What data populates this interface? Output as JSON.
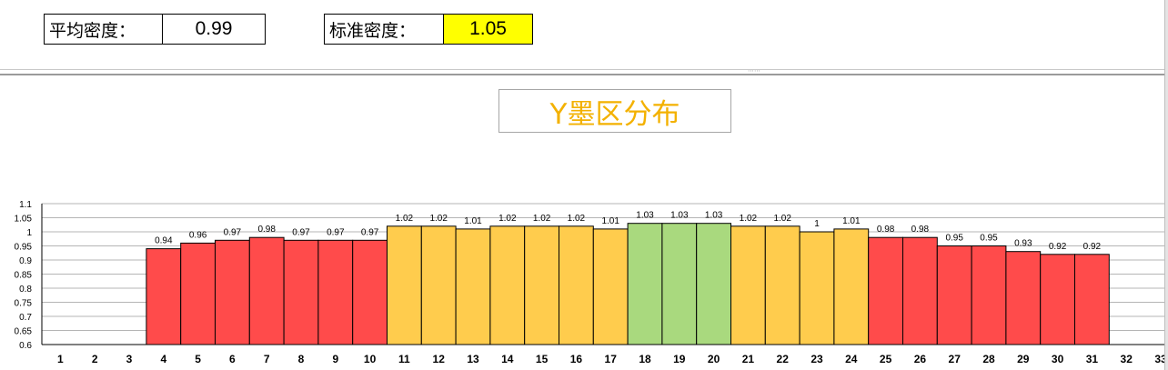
{
  "stats": {
    "avg_label": "平均密度：",
    "avg_value": "0.99",
    "std_label": "标准密度：",
    "std_value": "1.05",
    "std_highlight_color": "#ffff00"
  },
  "splitter_grip": "⋯⋯",
  "chart_data": {
    "type": "bar",
    "title": "Y墨区分布",
    "xlabel": "",
    "ylabel": "",
    "ylim": [
      0.6,
      1.1
    ],
    "yticks": [
      "0.6",
      "0.65",
      "0.7",
      "0.75",
      "0.8",
      "0.85",
      "0.9",
      "0.95",
      "1",
      "1.05",
      "1.1"
    ],
    "categories": [
      "1",
      "2",
      "3",
      "4",
      "5",
      "6",
      "7",
      "8",
      "9",
      "10",
      "11",
      "12",
      "13",
      "14",
      "15",
      "16",
      "17",
      "18",
      "19",
      "20",
      "21",
      "22",
      "23",
      "24",
      "25",
      "26",
      "27",
      "28",
      "29",
      "30",
      "31",
      "32",
      "33"
    ],
    "values": [
      null,
      null,
      null,
      0.94,
      0.96,
      0.97,
      0.98,
      0.97,
      0.97,
      0.97,
      1.02,
      1.02,
      1.01,
      1.02,
      1.02,
      1.02,
      1.01,
      1.03,
      1.03,
      1.03,
      1.02,
      1.02,
      1,
      1.01,
      0.98,
      0.98,
      0.95,
      0.95,
      0.93,
      0.92,
      0.92,
      null,
      null
    ],
    "value_labels": [
      "",
      "",
      "",
      "0.94",
      "0.96",
      "0.97",
      "0.98",
      "0.97",
      "0.97",
      "0.97",
      "1.02",
      "1.02",
      "1.01",
      "1.02",
      "1.02",
      "1.02",
      "1.01",
      "1.03",
      "1.03",
      "1.03",
      "1.02",
      "1.02",
      "1",
      "1.01",
      "0.98",
      "0.98",
      "0.95",
      "0.95",
      "0.93",
      "0.92",
      "0.92",
      "",
      ""
    ],
    "bar_colors": {
      "red": "#ff4b4b",
      "yellow": "#ffcc4d",
      "green": "#a9d97e"
    },
    "color_groups": [
      "",
      "",
      "",
      "red",
      "red",
      "red",
      "red",
      "red",
      "red",
      "red",
      "yellow",
      "yellow",
      "yellow",
      "yellow",
      "yellow",
      "yellow",
      "yellow",
      "green",
      "green",
      "green",
      "yellow",
      "yellow",
      "yellow",
      "yellow",
      "red",
      "red",
      "red",
      "red",
      "red",
      "red",
      "red",
      "",
      ""
    ],
    "title_color": "#f3b100",
    "grid": true,
    "legend": "none"
  }
}
